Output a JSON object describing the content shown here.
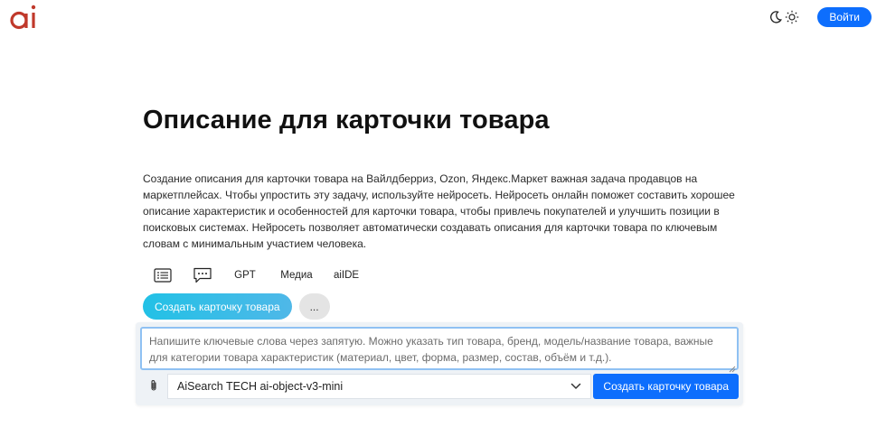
{
  "header": {
    "logo_text": "ai",
    "logo_color": "#c0392b",
    "theme_icons": [
      "moon-icon",
      "sun-icon"
    ],
    "login_label": "Войти"
  },
  "main": {
    "title": "Описание для карточки товара",
    "description": "Создание описания для карточки товара на Вайлдберриз, Ozon, Яндекс.Маркет важная задача продавцов на маркетплейсах. Чтобы упростить эту задачу, используйте нейросеть. Нейросеть онлайн поможет составить хорошее описание характеристик и особенностей для карточки товара, чтобы привлечь покупателей и улучшить позиции в поисковых системах. Нейросеть позволяет автоматически создавать описания для карточки товара по ключевым словам с минимальным участием человека."
  },
  "tabs": [
    {
      "icon": "list-icon",
      "label": ""
    },
    {
      "icon": "chat-icon",
      "label": ""
    },
    {
      "label": "GPT"
    },
    {
      "label": "Медиа"
    },
    {
      "label": "aiIDE"
    }
  ],
  "actions": {
    "primary_label": "Создать карточку товара",
    "more_label": "..."
  },
  "composer": {
    "placeholder": "Напишите ключевые слова через запятую. Можно указать тип товара, бренд, модель/название товара, важные для категории товара характеристик (материал, цвет, форма, размер, состав, объём и т.д.).",
    "value": "",
    "model": "AiSearch TECH ai-object-v3-mini",
    "submit_label": "Создать карточку товара"
  },
  "colors": {
    "accent": "#0d6efd",
    "pill_gradient_start": "#22c1e6",
    "pill_gradient_end": "#4fb8e8"
  }
}
